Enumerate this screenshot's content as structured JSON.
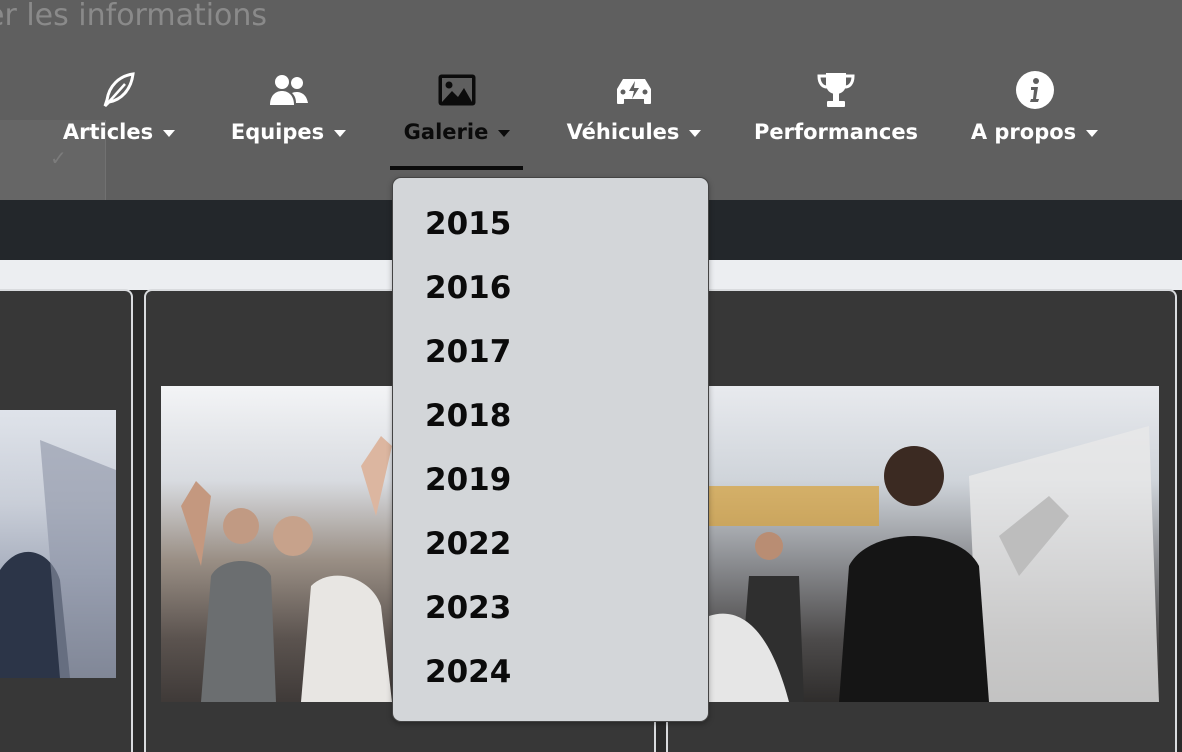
{
  "header": {
    "partial_text": "er les informations"
  },
  "nav": {
    "items": [
      {
        "label": "Articles",
        "icon": "feather-icon"
      },
      {
        "label": "Equipes",
        "icon": "users-icon"
      },
      {
        "label": "Galerie",
        "icon": "image-icon"
      },
      {
        "label": "Véhicules",
        "icon": "electric-car-icon"
      },
      {
        "label": "Performances",
        "icon": "trophy-icon"
      },
      {
        "label": "A propos",
        "icon": "info-icon"
      }
    ],
    "active": "Galerie"
  },
  "gallery_dropdown": {
    "items": [
      "2015",
      "2016",
      "2017",
      "2018",
      "2019",
      "2022",
      "2023",
      "2024"
    ]
  },
  "colors": {
    "header_bg": "#5f5f5f",
    "band_bg": "#23272b",
    "dropdown_bg": "#d3d6d9",
    "card_bg": "#373737"
  }
}
